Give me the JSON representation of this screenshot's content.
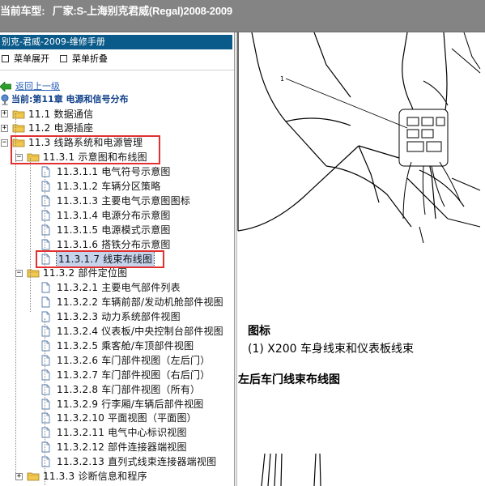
{
  "window": {
    "title_label": "当前车型:",
    "title_value": "厂家:S-上海别克君威(Regal)2008-2009"
  },
  "sidebar": {
    "panel_title": "别克-君威-2009-维修手册",
    "toolbar": {
      "expand_all": "菜单展开",
      "collapse_all": "菜单折叠"
    },
    "back_link": "返回上一级",
    "current_chapter": "当前:第11章 电源和信号分布",
    "tree": [
      {
        "label": "11.1 数据通信",
        "type": "folder",
        "expander": "+"
      },
      {
        "label": "11.2 电源插座",
        "type": "folder",
        "expander": "+"
      },
      {
        "label": "11.3 线路系统和电源管理",
        "type": "folder",
        "expander": "-"
      },
      {
        "label": "11.3.1 示意图和布线图",
        "type": "folder",
        "expander": "-"
      },
      {
        "label": "11.3.1.1 电气符号示意图",
        "type": "doc"
      },
      {
        "label": "11.3.1.2 车辆分区策略",
        "type": "doc"
      },
      {
        "label": "11.3.1.3 主要电气示意图图标",
        "type": "doc"
      },
      {
        "label": "11.3.1.4 电源分布示意图",
        "type": "doc"
      },
      {
        "label": "11.3.1.5 电源模式示意图",
        "type": "doc"
      },
      {
        "label": "11.3.1.6 搭铁分布示意图",
        "type": "doc"
      },
      {
        "label": "11.3.1.7 线束布线图",
        "type": "doc",
        "selected": true
      },
      {
        "label": "11.3.2 部件定位图",
        "type": "folder",
        "expander": "-"
      },
      {
        "label": "11.3.2.1 主要电气部件列表",
        "type": "doc"
      },
      {
        "label": "11.3.2.2 车辆前部/发动机舱部件视图",
        "type": "doc"
      },
      {
        "label": "11.3.2.3 动力系统部件视图",
        "type": "doc"
      },
      {
        "label": "11.3.2.4 仪表板/中央控制台部件视图",
        "type": "doc"
      },
      {
        "label": "11.3.2.5 乘客舱/车顶部件视图",
        "type": "doc"
      },
      {
        "label": "11.3.2.6 车门部件视图（左后门）",
        "type": "doc"
      },
      {
        "label": "11.3.2.7 车门部件视图（右后门）",
        "type": "doc"
      },
      {
        "label": "11.3.2.8 车门部件视图（所有）",
        "type": "doc"
      },
      {
        "label": "11.3.2.9 行李厢/车辆后部件视图",
        "type": "doc"
      },
      {
        "label": "11.3.2.10 平面视图（平面图）",
        "type": "doc"
      },
      {
        "label": "11.3.2.11 电气中心标识视图",
        "type": "doc"
      },
      {
        "label": "11.3.2.12 部件连接器端视图",
        "type": "doc"
      },
      {
        "label": "11.3.2.13 直列式线束连接器端视图",
        "type": "doc"
      },
      {
        "label": "11.3.3 诊断信息和程序",
        "type": "folder",
        "expander": "+"
      }
    ]
  },
  "content": {
    "callout_number": "1",
    "figure_label": "图标",
    "figure_caption": "(1) X200 车身线束和仪表板线束",
    "section_heading": "左后车门线束布线图"
  },
  "colors": {
    "title_bar_bg": "#848484",
    "panel_title_bg": "#0a5a8a",
    "folder_yellow": "#f0c850",
    "highlight_box": "#e03030",
    "selection_bg": "#c5d3ec",
    "link_blue": "#2a62b8"
  }
}
